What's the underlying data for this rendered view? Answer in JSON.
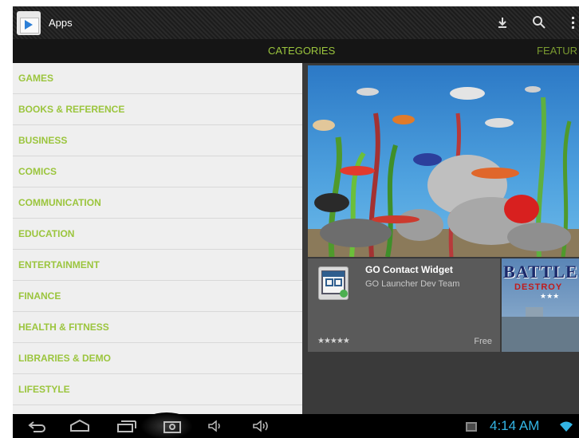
{
  "actionbar": {
    "title": "Apps",
    "icons": [
      "shopping-bag-icon",
      "download-icon",
      "search-icon",
      "overflow-menu-icon"
    ]
  },
  "tabs": {
    "active": "CATEGORIES",
    "next": "FEATUR"
  },
  "categories": [
    "GAMES",
    "BOOKS & REFERENCE",
    "BUSINESS",
    "COMICS",
    "COMMUNICATION",
    "EDUCATION",
    "ENTERTAINMENT",
    "FINANCE",
    "HEALTH & FITNESS",
    "LIBRARIES & DEMO",
    "LIFESTYLE"
  ],
  "featured": {
    "hero_alt": "aquarium-image",
    "cards": [
      {
        "title": "GO Contact Widget",
        "developer": "GO Launcher Dev Team",
        "stars": "★★★★★",
        "price": "Free"
      },
      {
        "title_line1": "BATTLES",
        "title_line2": "DESTROY",
        "stars": "★★★"
      }
    ]
  },
  "systembar": {
    "time": "4:14 AM",
    "icons": [
      "back-icon",
      "home-icon",
      "recent-apps-icon",
      "screenshot-icon",
      "volume-down-icon",
      "volume-up-icon",
      "gallery-notification-icon",
      "wifi-icon"
    ]
  },
  "colors": {
    "accent_green": "#9bc53d",
    "time_blue": "#33b5e5"
  }
}
